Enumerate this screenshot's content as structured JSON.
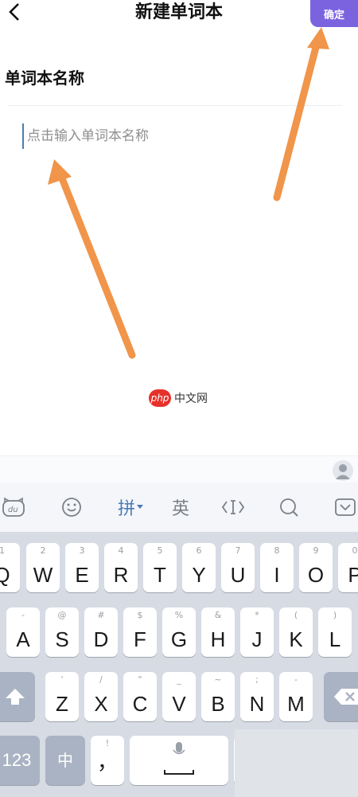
{
  "header": {
    "back_icon": "chevron-left-icon",
    "title": "新建单词本",
    "confirm_label": "确定"
  },
  "form": {
    "label": "单词本名称",
    "placeholder": "点击输入单词本名称"
  },
  "watermark": {
    "logo": "php",
    "text": "中文网"
  },
  "keyboard": {
    "toolbar": {
      "pinyin": "拼",
      "english": "英"
    },
    "row1": [
      {
        "sub": "1",
        "key": "Q"
      },
      {
        "sub": "2",
        "key": "W"
      },
      {
        "sub": "3",
        "key": "E"
      },
      {
        "sub": "4",
        "key": "R"
      },
      {
        "sub": "5",
        "key": "T"
      },
      {
        "sub": "6",
        "key": "Y"
      },
      {
        "sub": "7",
        "key": "U"
      },
      {
        "sub": "8",
        "key": "I"
      },
      {
        "sub": "9",
        "key": "O"
      },
      {
        "sub": "0",
        "key": "P"
      }
    ],
    "row2": [
      {
        "sub": "-",
        "key": "A"
      },
      {
        "sub": "@",
        "key": "S"
      },
      {
        "sub": "#",
        "key": "D"
      },
      {
        "sub": "$",
        "key": "F"
      },
      {
        "sub": "%",
        "key": "G"
      },
      {
        "sub": "&",
        "key": "H"
      },
      {
        "sub": "*",
        "key": "J"
      },
      {
        "sub": "(",
        "key": "K"
      },
      {
        "sub": ")",
        "key": "L"
      }
    ],
    "row3": [
      {
        "sub": "'",
        "key": "Z"
      },
      {
        "sub": "/",
        "key": "X"
      },
      {
        "sub": "\"",
        "key": "C"
      },
      {
        "sub": "_",
        "key": "V"
      },
      {
        "sub": "~",
        "key": "B"
      },
      {
        "sub": ";",
        "key": "N"
      },
      {
        "sub": "-",
        "key": "M"
      }
    ],
    "bottom": {
      "num_label": "123",
      "lang_label": "中",
      "comma": "，"
    }
  }
}
